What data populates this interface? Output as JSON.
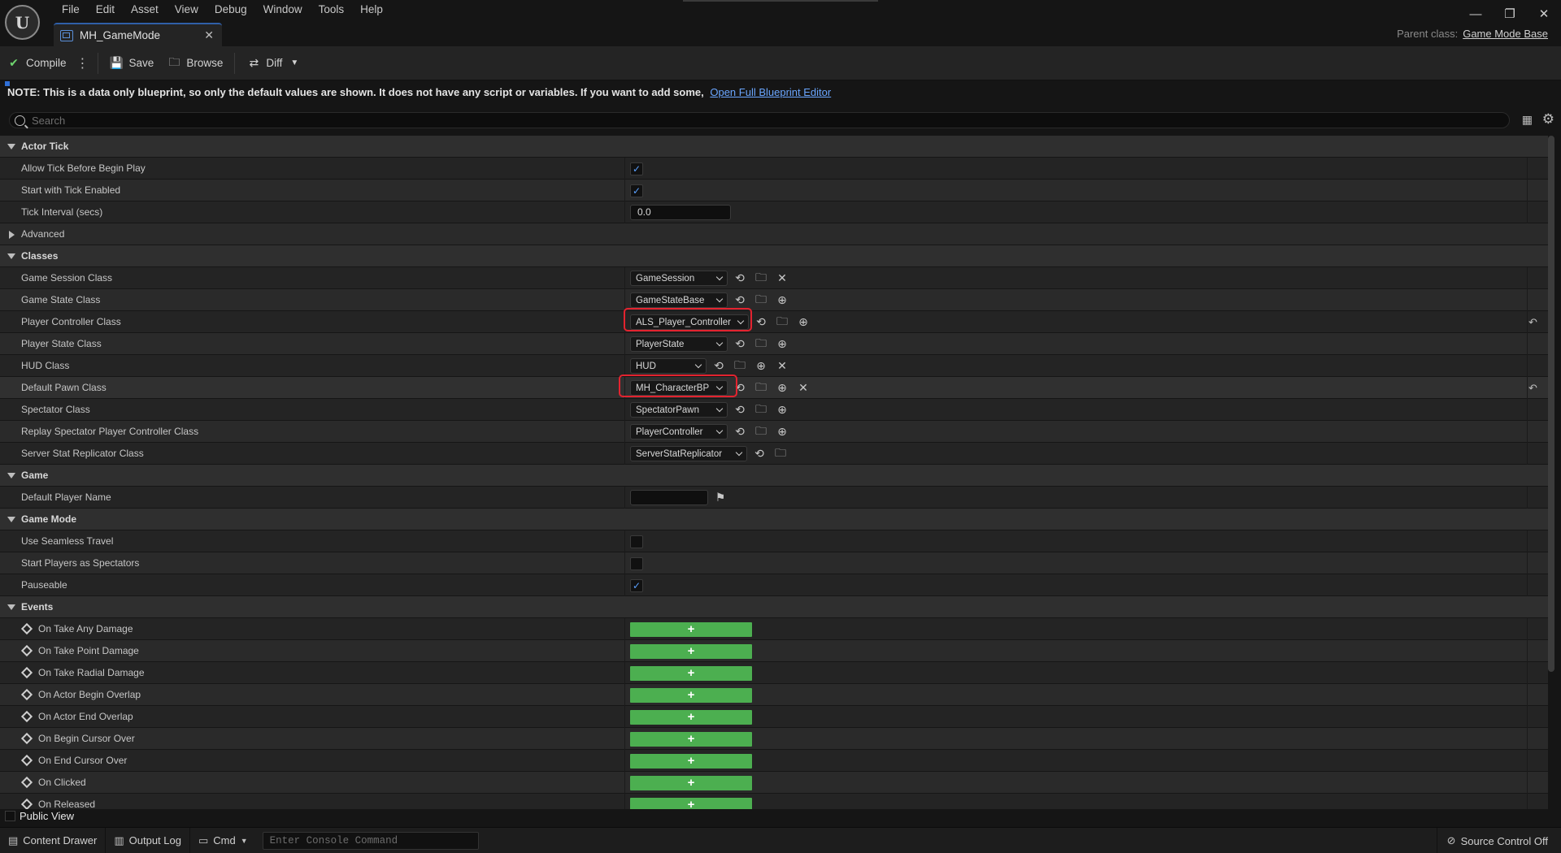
{
  "menu": [
    "File",
    "Edit",
    "Asset",
    "View",
    "Debug",
    "Window",
    "Tools",
    "Help"
  ],
  "tab": {
    "title": "MH_GameMode"
  },
  "parent_class": {
    "label": "Parent class:",
    "value": "Game Mode Base"
  },
  "toolbar": {
    "compile": "Compile",
    "save": "Save",
    "browse": "Browse",
    "diff": "Diff"
  },
  "notice": {
    "text": "NOTE: This is a data only blueprint, so only the default values are shown.  It does not have any script or variables.  If you want to add some,",
    "link": "Open Full Blueprint Editor"
  },
  "search": {
    "placeholder": "Search"
  },
  "sections": {
    "actor_tick": {
      "title": "Actor Tick",
      "allow_tick": {
        "label": "Allow Tick Before Begin Play",
        "checked": true
      },
      "start_tick": {
        "label": "Start with Tick Enabled",
        "checked": true
      },
      "tick_interval": {
        "label": "Tick Interval (secs)",
        "value": "0.0"
      },
      "advanced": "Advanced"
    },
    "classes": {
      "title": "Classes",
      "game_session": {
        "label": "Game Session Class",
        "value": "GameSession"
      },
      "game_state": {
        "label": "Game State Class",
        "value": "GameStateBase"
      },
      "player_controller": {
        "label": "Player Controller Class",
        "value": "ALS_Player_Controller"
      },
      "player_state": {
        "label": "Player State Class",
        "value": "PlayerState"
      },
      "hud": {
        "label": "HUD Class",
        "value": "HUD"
      },
      "default_pawn": {
        "label": "Default Pawn Class",
        "value": "MH_CharacterBP"
      },
      "spectator": {
        "label": "Spectator Class",
        "value": "SpectatorPawn"
      },
      "replay_spectator": {
        "label": "Replay Spectator Player Controller Class",
        "value": "PlayerController"
      },
      "server_stat": {
        "label": "Server Stat Replicator Class",
        "value": "ServerStatReplicator"
      }
    },
    "game": {
      "title": "Game",
      "default_player_name": {
        "label": "Default Player Name",
        "value": ""
      }
    },
    "game_mode": {
      "title": "Game Mode",
      "seamless": {
        "label": "Use Seamless Travel",
        "checked": false
      },
      "start_spectators": {
        "label": "Start Players as Spectators",
        "checked": false
      },
      "pauseable": {
        "label": "Pauseable",
        "checked": true
      }
    },
    "events": {
      "title": "Events",
      "items": [
        "On Take Any Damage",
        "On Take Point Damage",
        "On Take Radial Damage",
        "On Actor Begin Overlap",
        "On Actor End Overlap",
        "On Begin Cursor Over",
        "On End Cursor Over",
        "On Clicked",
        "On Released"
      ]
    }
  },
  "public_view": "Public View",
  "statusbar": {
    "content_drawer": "Content Drawer",
    "output_log": "Output Log",
    "cmd": "Cmd",
    "console_placeholder": "Enter Console Command",
    "source_control": "Source Control Off"
  },
  "colors": {
    "accent": "#2f5fa8",
    "event_green": "#4caf50",
    "annotation_red": "#e3232f",
    "checkmark": "#5aa0ff"
  }
}
